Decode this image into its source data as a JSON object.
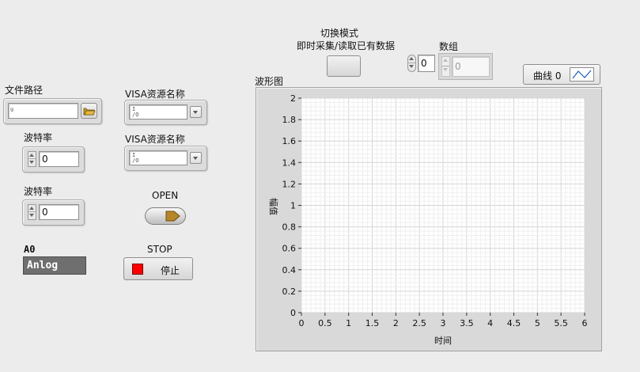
{
  "file_path": {
    "label": "文件路径",
    "value": ""
  },
  "baud_rate_1": {
    "label": "波特率",
    "value": "0"
  },
  "baud_rate_2": {
    "label": "波特率",
    "value": "0"
  },
  "visa_1": {
    "label": "VISA资源名称",
    "value": ""
  },
  "visa_2": {
    "label": "VISA资源名称",
    "value": ""
  },
  "open_button": {
    "label": "OPEN"
  },
  "stop_button": {
    "label": "STOP",
    "text": "停止",
    "led_color": "#ff0000"
  },
  "ao_indicator": {
    "label": "A0",
    "value": "Anlog"
  },
  "mode_switch": {
    "label_line1": "切换模式",
    "label_line2": "即时采集/读取已有数据"
  },
  "array": {
    "label": "数组",
    "index": "0",
    "element": "0"
  },
  "plot_legend": {
    "name": "曲线 0"
  },
  "graph": {
    "label": "波形图",
    "x_label": "时间",
    "y_label": "幅值"
  },
  "chart_data": {
    "type": "line",
    "xlabel": "时间",
    "ylabel": "幅值",
    "xlim": [
      0,
      6
    ],
    "ylim": [
      0,
      2
    ],
    "x_ticks": [
      "0",
      "0.5",
      "1",
      "1.5",
      "2",
      "2.5",
      "3",
      "3.5",
      "4",
      "4.5",
      "5",
      "5.5",
      "6"
    ],
    "y_ticks": [
      "0",
      "0.2",
      "0.4",
      "0.6",
      "0.8",
      "1",
      "1.2",
      "1.4",
      "1.6",
      "1.8",
      "2"
    ],
    "grid": true,
    "series": []
  }
}
